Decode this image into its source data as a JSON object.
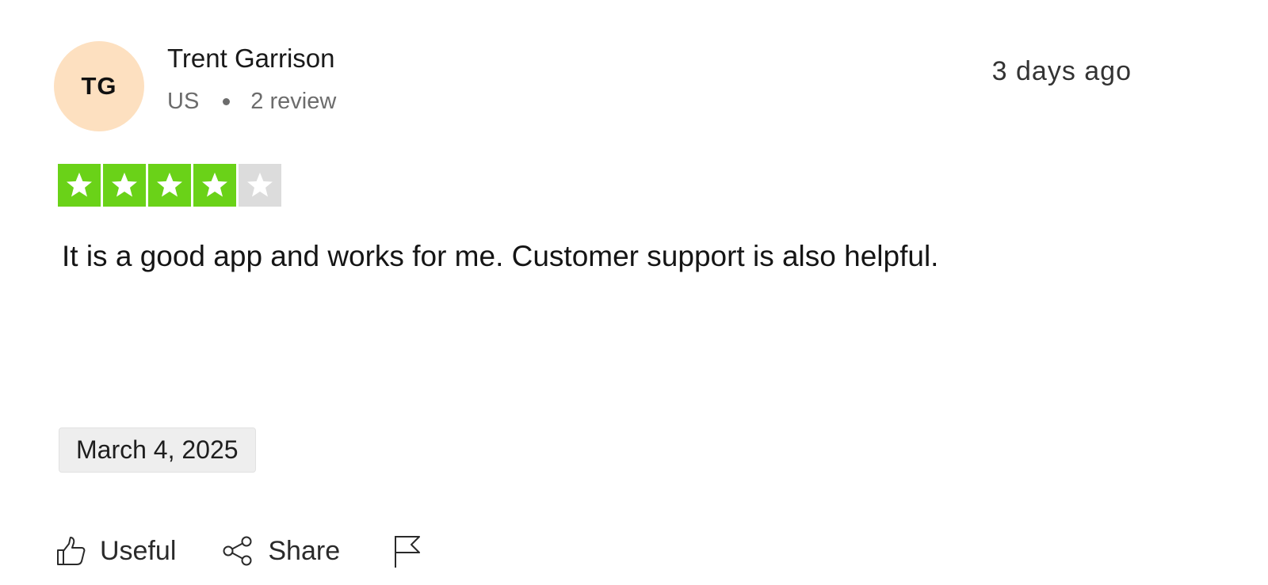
{
  "review": {
    "avatar_initials": "TG",
    "avatar_color": "#fde0c0",
    "reviewer_name": "Trent Garrison",
    "country": "US",
    "review_count": "2 review",
    "time_ago": "3 days ago",
    "rating": 4,
    "rating_max": 5,
    "star_color_on": "#6ad218",
    "star_color_off": "#dcdcdc",
    "body": "It is a good app and works for me. Customer support is also helpful.",
    "experience_date": "March 4, 2025"
  },
  "actions": {
    "useful_label": "Useful",
    "useful_icon": "thumbs-up-icon",
    "share_label": "Share",
    "share_icon": "share-icon",
    "report_icon": "flag-icon"
  }
}
